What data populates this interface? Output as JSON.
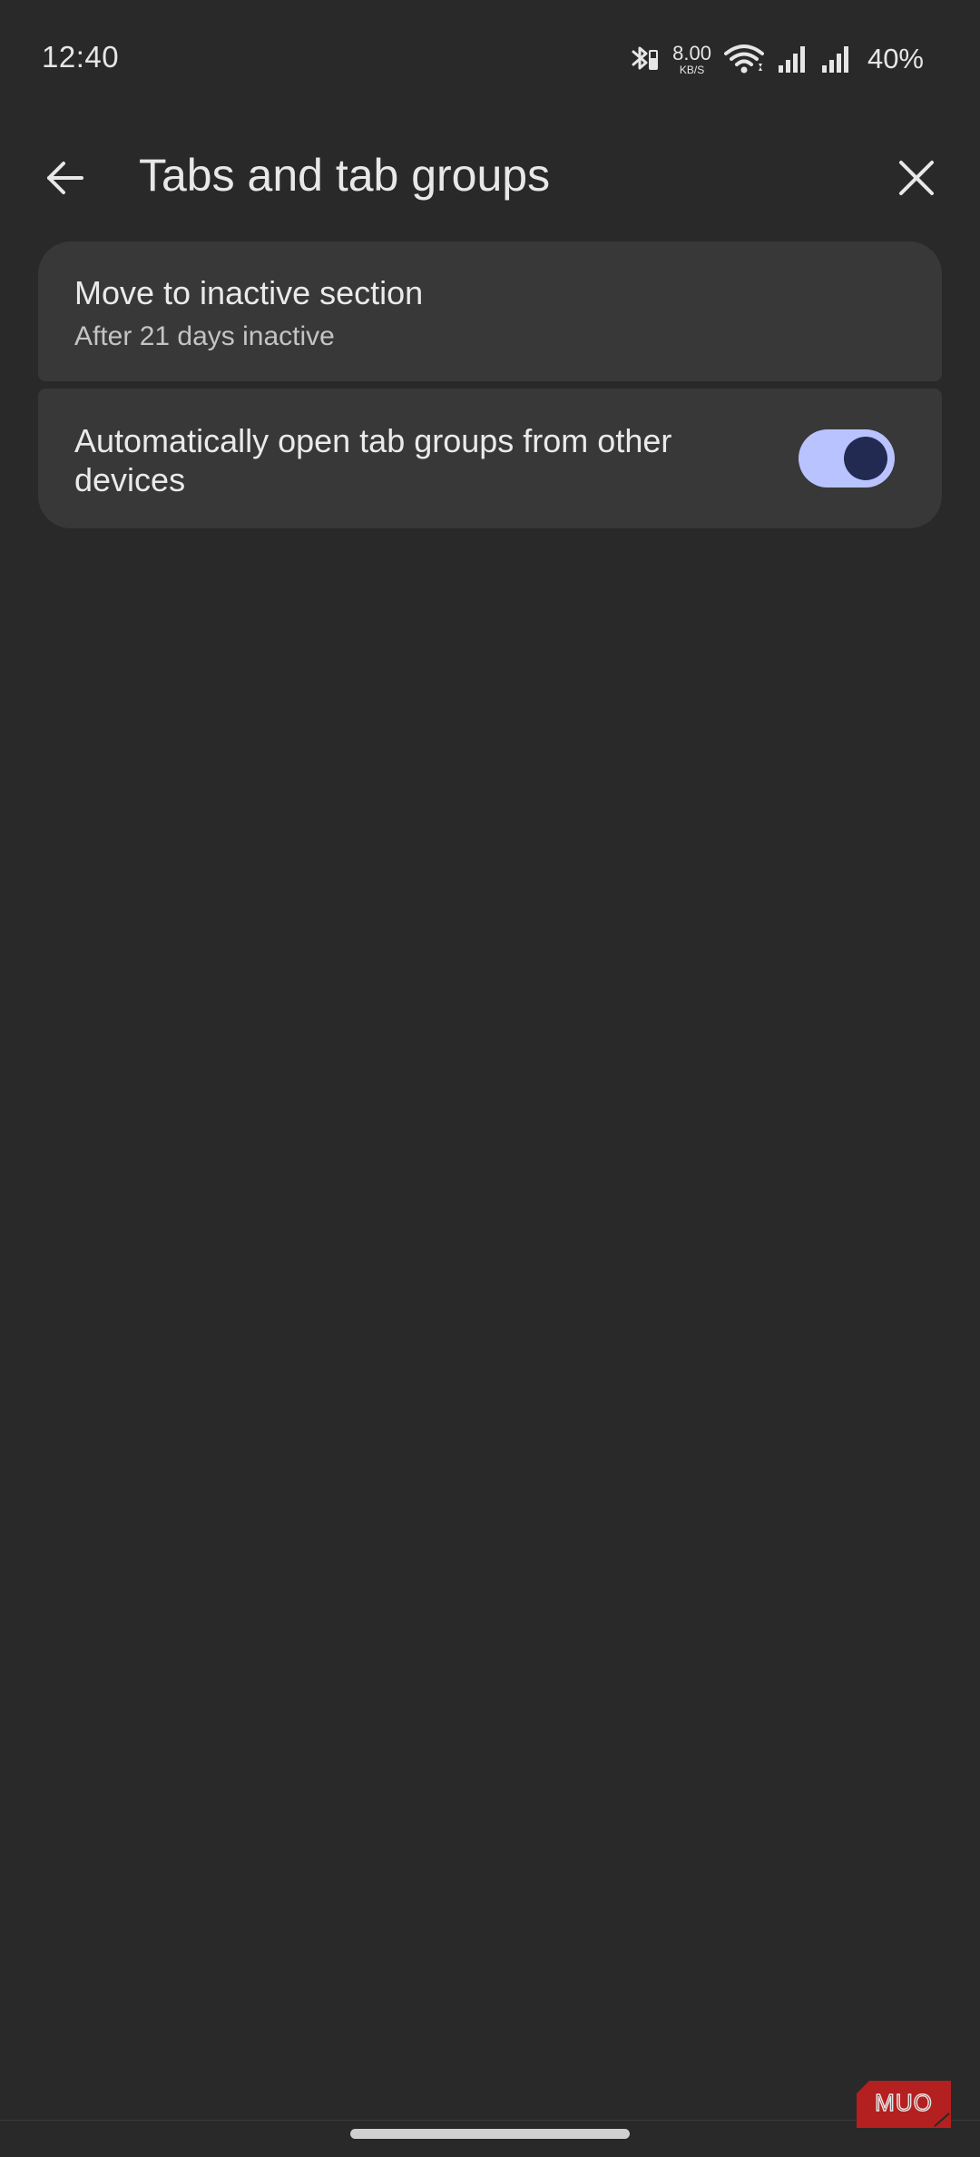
{
  "status_bar": {
    "time": "12:40",
    "net_speed_value": "8.00",
    "net_speed_unit": "KB/S",
    "battery": "40%",
    "icons": [
      "bluetooth-icon",
      "wifi-icon",
      "signal-icon",
      "signal-icon"
    ]
  },
  "app_bar": {
    "title": "Tabs and tab groups",
    "back_icon": "arrow-back-icon",
    "close_icon": "close-icon"
  },
  "settings": {
    "inactive": {
      "title": "Move to inactive section",
      "summary": "After 21 days inactive"
    },
    "auto_open": {
      "label": "Automatically open tab groups from other devices",
      "checked": true
    }
  },
  "watermark": {
    "text": "MUO"
  },
  "colors": {
    "background": "#292929",
    "card": "#383838",
    "toggle_track": "#b9c3ff",
    "toggle_knob": "#232a52",
    "watermark": "#b3201f"
  }
}
